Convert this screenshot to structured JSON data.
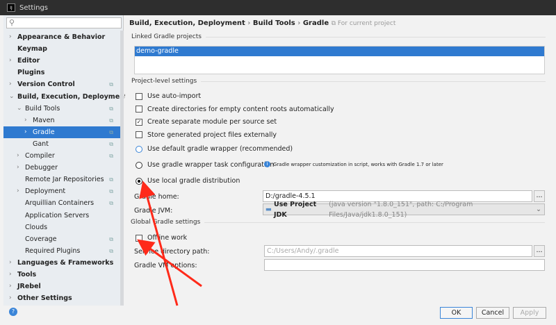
{
  "window": {
    "title": "Settings",
    "logo": "IJ"
  },
  "search": {
    "placeholder": ""
  },
  "sidebar": {
    "items": [
      {
        "label": "Appearance & Behavior",
        "bold": true,
        "arrow": "right",
        "indent": 0
      },
      {
        "label": "Keymap",
        "bold": true,
        "arrow": "",
        "indent": 0
      },
      {
        "label": "Editor",
        "bold": true,
        "arrow": "right",
        "indent": 0
      },
      {
        "label": "Plugins",
        "bold": true,
        "arrow": "",
        "indent": 0
      },
      {
        "label": "Version Control",
        "bold": true,
        "arrow": "right",
        "indent": 0,
        "copy": true
      },
      {
        "label": "Build, Execution, Deployment",
        "bold": true,
        "arrow": "down",
        "indent": 0
      },
      {
        "label": "Build Tools",
        "bold": false,
        "arrow": "down",
        "indent": 1,
        "copy": true
      },
      {
        "label": "Maven",
        "bold": false,
        "arrow": "right",
        "indent": 2,
        "copy": true
      },
      {
        "label": "Gradle",
        "bold": false,
        "arrow": "right",
        "indent": 2,
        "copy": true,
        "selected": true
      },
      {
        "label": "Gant",
        "bold": false,
        "arrow": "",
        "indent": 2,
        "copy": true
      },
      {
        "label": "Compiler",
        "bold": false,
        "arrow": "right",
        "indent": 1,
        "copy": true
      },
      {
        "label": "Debugger",
        "bold": false,
        "arrow": "right",
        "indent": 1
      },
      {
        "label": "Remote Jar Repositories",
        "bold": false,
        "arrow": "",
        "indent": 1,
        "copy": true
      },
      {
        "label": "Deployment",
        "bold": false,
        "arrow": "right",
        "indent": 1,
        "copy": true
      },
      {
        "label": "Arquillian Containers",
        "bold": false,
        "arrow": "",
        "indent": 1,
        "copy": true
      },
      {
        "label": "Application Servers",
        "bold": false,
        "arrow": "",
        "indent": 1
      },
      {
        "label": "Clouds",
        "bold": false,
        "arrow": "",
        "indent": 1
      },
      {
        "label": "Coverage",
        "bold": false,
        "arrow": "",
        "indent": 1,
        "copy": true
      },
      {
        "label": "Required Plugins",
        "bold": false,
        "arrow": "",
        "indent": 1,
        "copy": true
      },
      {
        "label": "Languages & Frameworks",
        "bold": true,
        "arrow": "right",
        "indent": 0
      },
      {
        "label": "Tools",
        "bold": true,
        "arrow": "right",
        "indent": 0
      },
      {
        "label": "JRebel",
        "bold": true,
        "arrow": "right",
        "indent": 0
      },
      {
        "label": "Other Settings",
        "bold": true,
        "arrow": "right",
        "indent": 0
      }
    ]
  },
  "breadcrumb": {
    "parts": [
      "Build, Execution, Deployment",
      "Build Tools",
      "Gradle"
    ],
    "sep": "›",
    "scope": "For current project"
  },
  "linked": {
    "title": "Linked Gradle projects",
    "projects": [
      "demo-gradle"
    ]
  },
  "project": {
    "title": "Project-level settings",
    "checkboxes": [
      {
        "label": "Use auto-import",
        "checked": false
      },
      {
        "label": "Create directories for empty content roots automatically",
        "checked": false
      },
      {
        "label": "Create separate module per source set",
        "checked": true
      },
      {
        "label": "Store generated project files externally",
        "checked": false
      }
    ],
    "radios": [
      {
        "label": "Use default gradle wrapper (recommended)",
        "checked": false
      },
      {
        "label": "Use gradle wrapper task configuration",
        "checked": false
      },
      {
        "label": "Use local gradle distribution",
        "checked": true
      }
    ],
    "wrapper_info": "Gradle wrapper customization in script, works with Gradle 1.7 or later",
    "gradle_home_label": "Gradle home:",
    "gradle_home": "D:/gradle-4.5.1",
    "jvm_label": "Gradle JVM:",
    "jvm_main": "Use Project JDK",
    "jvm_detail": "(java version \"1.8.0_151\", path: C:/Program Files/Java/jdk1.8.0_151)"
  },
  "global": {
    "title": "Global Gradle settings",
    "offline_label": "Offline work",
    "offline": false,
    "service_label": "Service directory path:",
    "service_placeholder": "C:/Users/Andy/.gradle",
    "vm_label": "Gradle VM options:",
    "vm_value": ""
  },
  "buttons": {
    "browse": "...",
    "ok": "OK",
    "cancel": "Cancel",
    "apply": "Apply",
    "help": "?"
  },
  "colors": {
    "accent": "#2f7ad0",
    "arrow": "#ff2a1a"
  }
}
